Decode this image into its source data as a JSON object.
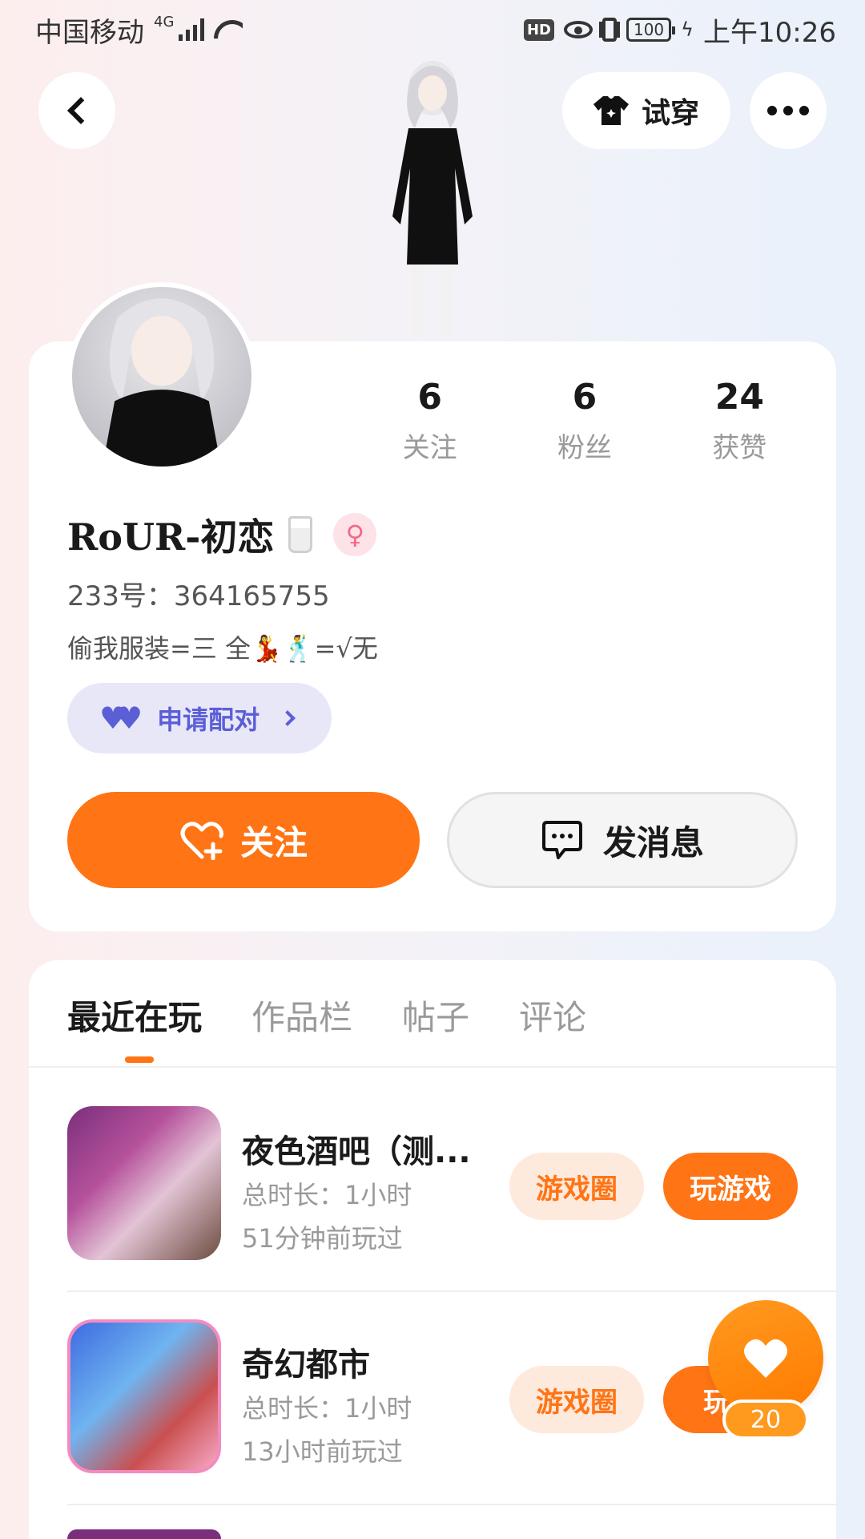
{
  "status_bar": {
    "carrier": "中国移动",
    "network": "4G",
    "hd": "HD",
    "battery": "100",
    "time": "上午10:26"
  },
  "header": {
    "tryon_label": "试穿"
  },
  "profile": {
    "stats": [
      {
        "value": "6",
        "label": "关注"
      },
      {
        "value": "6",
        "label": "粉丝"
      },
      {
        "value": "24",
        "label": "获赞"
      }
    ],
    "nickname": "RoUR-初恋",
    "gender_symbol": "♀",
    "uid": "233号：364165755",
    "bio": "偷我服装=三 全💃🕺=√无",
    "pair_label": "申请配对",
    "follow_label": "关注",
    "message_label": "发消息"
  },
  "tabs": [
    "最近在玩",
    "作品栏",
    "帖子",
    "评论"
  ],
  "games": [
    {
      "title": "夜色酒吧（测...",
      "duration": "总时长：1小时",
      "last_played": "51分钟前玩过",
      "circle_label": "游戏圈",
      "play_label": "玩游戏"
    },
    {
      "title": "奇幻都市",
      "duration": "总时长：1小时",
      "last_played": "13小时前玩过",
      "circle_label": "游戏圈",
      "play_label": "玩游"
    }
  ],
  "like_fab": {
    "count": "20"
  },
  "colors": {
    "accent_orange": "#ff7414",
    "pair_purple": "#5b5fd6"
  }
}
